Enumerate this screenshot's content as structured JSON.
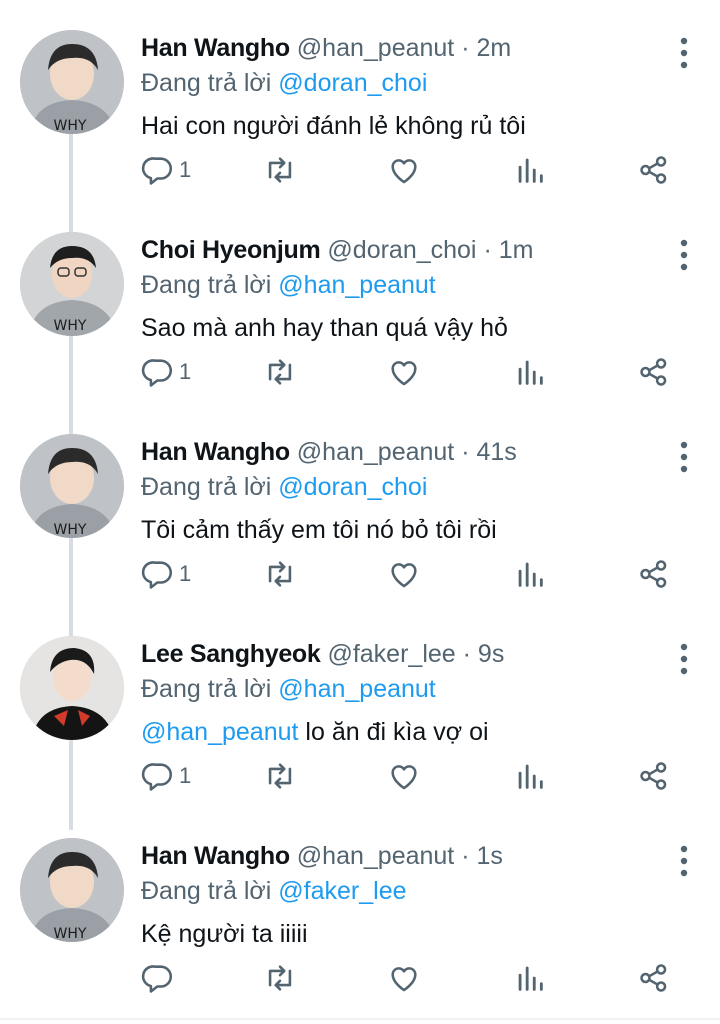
{
  "colors": {
    "accent": "#1d9bf0",
    "muted": "#536471",
    "text": "#0f1419",
    "thread": "#d7dde2"
  },
  "reply_prefix": "Đang trả lời",
  "tweets": [
    {
      "name": "Han Wangho",
      "handle": "@han_peanut",
      "time": "· 2m",
      "reply_to": "@doran_choi",
      "mention": "",
      "text": "Hai con người đánh lẻ không rủ tôi",
      "reply_count": "1"
    },
    {
      "name": "Choi Hyeonjum",
      "handle": "@doran_choi",
      "time": "· 1m",
      "reply_to": "@han_peanut",
      "mention": "",
      "text": "Sao mà anh hay than quá vậy hỏ",
      "reply_count": "1"
    },
    {
      "name": "Han Wangho",
      "handle": "@han_peanut",
      "time": "· 41s",
      "reply_to": "@doran_choi",
      "mention": "",
      "text": "Tôi cảm thấy em tôi nó bỏ tôi rồi",
      "reply_count": "1"
    },
    {
      "name": "Lee Sanghyeok",
      "handle": "@faker_lee",
      "time": "· 9s",
      "reply_to": "@han_peanut",
      "mention": "@han_peanut",
      "text": "lo ăn đi kìa vợ oi",
      "reply_count": "1"
    },
    {
      "name": "Han Wangho",
      "handle": "@han_peanut",
      "time": "· 1s",
      "reply_to": "@faker_lee",
      "mention": "",
      "text": "Kệ người ta iiiii",
      "reply_count": ""
    }
  ],
  "icons": [
    "more-vertical-icon",
    "reply-icon",
    "retweet-icon",
    "like-icon",
    "analytics-icon",
    "share-icon"
  ]
}
